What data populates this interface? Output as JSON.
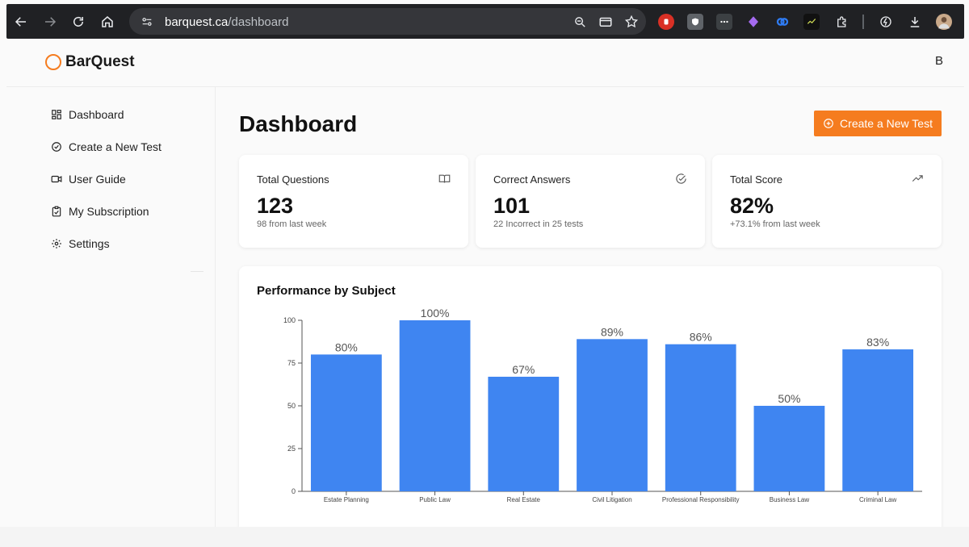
{
  "browser": {
    "url_host": "barquest.ca",
    "url_path": "/dashboard"
  },
  "app": {
    "logo_text": "BarQuest",
    "avatar_initial": "B",
    "accent_color": "#f57c1f",
    "bar_color": "#3f85f1"
  },
  "sidebar": {
    "items": [
      {
        "label": "Dashboard",
        "icon": "dashboard-grid-icon"
      },
      {
        "label": "Create a New Test",
        "icon": "circle-check-icon"
      },
      {
        "label": "User Guide",
        "icon": "video-camera-icon"
      },
      {
        "label": "My Subscription",
        "icon": "clipboard-icon"
      },
      {
        "label": "Settings",
        "icon": "gear-icon"
      }
    ]
  },
  "main": {
    "title": "Dashboard",
    "create_button_label": "Create a New Test",
    "cards": [
      {
        "label": "Total Questions",
        "value": "123",
        "sub": "98 from last week",
        "icon": "book-open-icon"
      },
      {
        "label": "Correct Answers",
        "value": "101",
        "sub": "22 Incorrect in 25 tests",
        "icon": "check-circle-icon"
      },
      {
        "label": "Total Score",
        "value": "82%",
        "sub": "+73.1% from last week",
        "icon": "trending-up-icon"
      }
    ],
    "chart_title": "Performance by Subject"
  },
  "chart_data": {
    "type": "bar",
    "title": "Performance by Subject",
    "categories": [
      "Estate Planning",
      "Public Law",
      "Real Estate",
      "Civil Litigation",
      "Professional Responsibility",
      "Business Law",
      "Criminal Law"
    ],
    "values": [
      80,
      100,
      67,
      89,
      86,
      50,
      83
    ],
    "data_labels": [
      "80%",
      "100%",
      "67%",
      "89%",
      "86%",
      "50%",
      "83%"
    ],
    "yticks": [
      0,
      25,
      50,
      75,
      100
    ],
    "ylim": [
      0,
      100
    ],
    "grid": false,
    "legend": "none"
  }
}
